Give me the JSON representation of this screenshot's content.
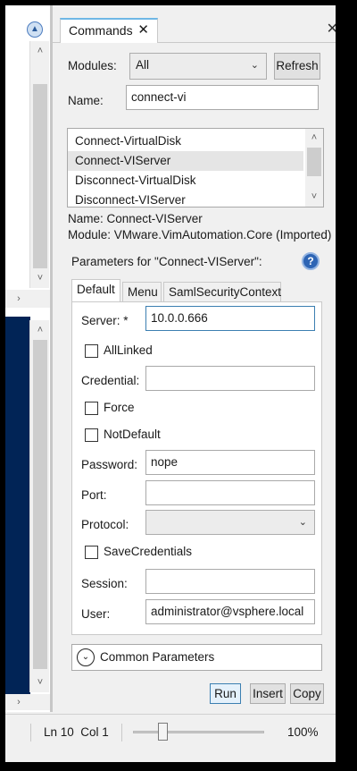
{
  "window": {
    "close_glyph": "✕"
  },
  "panel": {
    "tab_label": "Commands",
    "tab_close_glyph": "✕",
    "modules_label": "Modules:",
    "modules_value": "All",
    "refresh_label": "Refresh",
    "name_label": "Name:",
    "name_value": "connect-vi",
    "commands_list": [
      {
        "label": "Connect-VirtualDisk",
        "selected": false
      },
      {
        "label": "Connect-VIServer",
        "selected": true
      },
      {
        "label": "Disconnect-VirtualDisk",
        "selected": false
      },
      {
        "label": "Disconnect-VIServer",
        "selected": false
      }
    ],
    "info_name": "Name: Connect-VIServer",
    "info_module": "Module: VMware.VimAutomation.Core (Imported)",
    "params_for": "Parameters for \"Connect-VIServer\":",
    "help_glyph": "?",
    "param_tabs": [
      "Default",
      "Menu",
      "SamlSecurityContext"
    ],
    "active_param_tab": "Default",
    "params": {
      "server_label": "Server: *",
      "server_value": "10.0.0.666",
      "alllinked_label": "AllLinked",
      "credential_label": "Credential:",
      "credential_value": "",
      "force_label": "Force",
      "notdefault_label": "NotDefault",
      "password_label": "Password:",
      "password_value": "nope",
      "port_label": "Port:",
      "port_value": "",
      "protocol_label": "Protocol:",
      "protocol_value": "",
      "savecredentials_label": "SaveCredentials",
      "session_label": "Session:",
      "session_value": "",
      "user_label": "User:",
      "user_value": "administrator@vsphere.local"
    },
    "common_parameters_label": "Common Parameters",
    "run_label": "Run",
    "insert_label": "Insert",
    "copy_label": "Copy"
  },
  "statusbar": {
    "position": "Ln 10  Col 1",
    "zoom": "100%"
  },
  "colors": {
    "console_bg": "#012456",
    "accent_blue": "#3c7fb1",
    "tab_top": "#6fb7e5",
    "help_blue": "#2e65b4"
  },
  "icons": {
    "chevron_down": "⌄",
    "scroll_up": "˄",
    "scroll_down": "˅",
    "scroll_right": "›"
  }
}
